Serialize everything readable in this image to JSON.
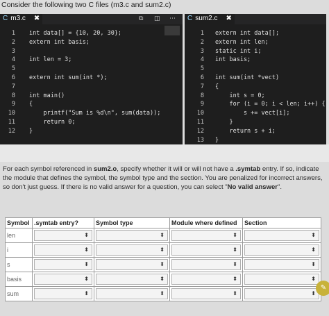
{
  "intro": "Consider the following two C files (m3.c and sum2.c)",
  "left_pane": {
    "tab_icon": "C",
    "tab_label": "m3.c",
    "close_glyph": "✖",
    "lines": [
      {
        "n": "1",
        "code": "int data[] = {10, 20, 30};"
      },
      {
        "n": "2",
        "code": "extern int basis;"
      },
      {
        "n": "3",
        "code": ""
      },
      {
        "n": "4",
        "code": "int len = 3;"
      },
      {
        "n": "5",
        "code": ""
      },
      {
        "n": "6",
        "code": "extern int sum(int *);"
      },
      {
        "n": "7",
        "code": ""
      },
      {
        "n": "8",
        "code": "int main()"
      },
      {
        "n": "9",
        "code": "{"
      },
      {
        "n": "10",
        "code": "    printf(\"Sum is %d\\n\", sum(data));"
      },
      {
        "n": "11",
        "code": "    return 0;"
      },
      {
        "n": "12",
        "code": "}"
      }
    ]
  },
  "right_pane": {
    "tab_icon": "C",
    "tab_label": "sum2.c",
    "close_glyph": "✖",
    "lines": [
      {
        "n": "1",
        "code": "extern int data[];"
      },
      {
        "n": "2",
        "code": "extern int len;"
      },
      {
        "n": "3",
        "code": "static int i;"
      },
      {
        "n": "4",
        "code": "int basis;"
      },
      {
        "n": "5",
        "code": ""
      },
      {
        "n": "6",
        "code": "int sum(int *vect)"
      },
      {
        "n": "7",
        "code": "{"
      },
      {
        "n": "8",
        "code": "    int s = 0;"
      },
      {
        "n": "9",
        "code": "    for (i = 0; i < len; i++) {"
      },
      {
        "n": "10",
        "code": "        s += vect[i];"
      },
      {
        "n": "11",
        "code": "    }"
      },
      {
        "n": "12",
        "code": "    return s + i;"
      },
      {
        "n": "13",
        "code": "}"
      }
    ]
  },
  "question": {
    "p1": "For each symbol referenced in ",
    "file": "sum2.o",
    "p2": ", specify whether it will or will not have a ",
    "section": ".symtab",
    "p3": " entry. If so, indicate the module that defines the symbol, the symbol type and the section. You are penalized for incorrect answers, so don't just guess. If there is no valid answer for a question, you can select \"",
    "novalid": "No valid answer",
    "p4": "\"."
  },
  "table": {
    "headers": [
      "Symbol",
      ".symtab entry?",
      "Symbol type",
      "Module where defined",
      "Section"
    ],
    "rows": [
      "len",
      "i",
      "s",
      "basis",
      "sum"
    ],
    "select_value": ""
  },
  "toolbar_icons": [
    "split-icon",
    "layout-icon",
    "more-icon"
  ]
}
